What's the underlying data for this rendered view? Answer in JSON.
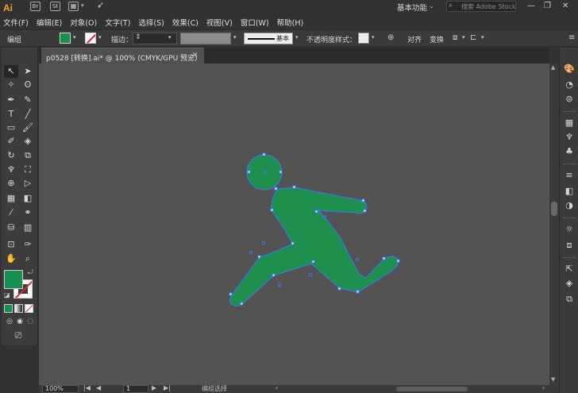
{
  "app": {
    "logo": "Ai",
    "bridge": "Br",
    "stock": "St"
  },
  "menu": [
    "文件(F)",
    "编辑(E)",
    "对象(O)",
    "文字(T)",
    "选择(S)",
    "效果(C)",
    "视图(V)",
    "窗口(W)",
    "帮助(H)"
  ],
  "workspace": {
    "label": "基本功能"
  },
  "search": {
    "placeholder": "搜索 Adobe Stock"
  },
  "window_controls": {
    "minimize": "—",
    "restore": "❐",
    "close": "✕"
  },
  "control_bar": {
    "selection": "编组",
    "stroke_label": "描边：",
    "brush_label": "基本",
    "opacity_label": "不透明度",
    "style_label": "样式：",
    "align_label": "对齐",
    "transform_label": "变换",
    "fill_color": "#17904f",
    "stroke_color": "none"
  },
  "document": {
    "tab_title": "p0528 [转换].ai* @ 100% (CMYK/GPU 预览)",
    "close": "✕"
  },
  "artwork": {
    "figure_color": "#1f8f4e",
    "anchor_color": "#3a78ff"
  },
  "status": {
    "zoom": "100%",
    "artboard": "1",
    "tool": "编组选择",
    "nav_first": "|◀",
    "nav_prev": "◀",
    "nav_next": "▶",
    "nav_last": "▶|"
  },
  "icons": {
    "selection": "selection-arrow-icon",
    "direct": "direct-selection-icon",
    "fill": "fill-swatch",
    "stroke": "stroke-swatch"
  }
}
